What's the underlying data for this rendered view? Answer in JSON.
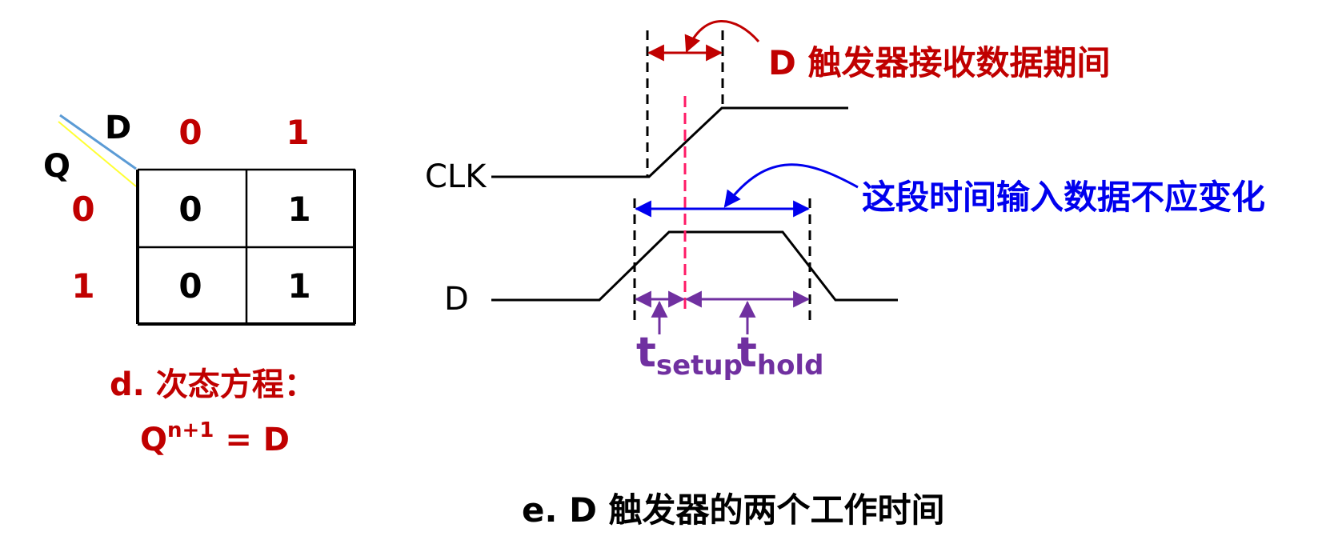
{
  "kmap": {
    "col_var": "D",
    "row_var": "Q",
    "col_headers": [
      "0",
      "1"
    ],
    "row_headers": [
      "0",
      "1"
    ],
    "cells": [
      [
        "0",
        "1"
      ],
      [
        "0",
        "1"
      ]
    ]
  },
  "equation": {
    "label": "d. 次态方程：",
    "lhs": "Q",
    "superscript": "n+1",
    "rhs": " = D"
  },
  "timing": {
    "clk_label": "CLK",
    "d_label": "D",
    "receive_note": "D 触发器接收数据期间",
    "stable_note": "这段时间输入数据不应变化",
    "setup_main": "t",
    "setup_sub": "setup",
    "hold_main": "t",
    "hold_sub": "hold"
  },
  "caption": "e. D 触发器的两个工作时间",
  "colors": {
    "red": "#c00000",
    "blue": "#0000ee",
    "purple": "#7030a0",
    "pink": "#ff1a66",
    "black": "#000000",
    "diag_blue": "#5b9bd5",
    "diag_yellow": "#ffff33"
  }
}
